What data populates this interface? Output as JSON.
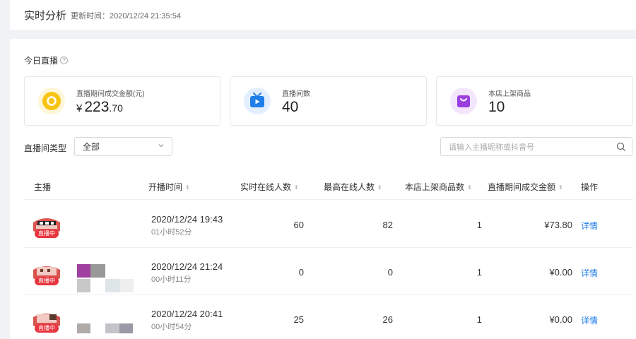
{
  "header": {
    "title": "实时分析",
    "update_label": "更新时间：2020/12/24 21:35:54"
  },
  "section": {
    "title": "今日直播",
    "help_icon": "question-circle-icon"
  },
  "stats": [
    {
      "label": "直播期间成交金额(元)",
      "currency": "¥",
      "integer": "223",
      "decimal": ".70",
      "icon": "coin-icon",
      "color": "#f8c514"
    },
    {
      "label": "直播间数",
      "value": "40",
      "icon": "tv-icon",
      "color": "#1f7ee8"
    },
    {
      "label": "本店上架商品",
      "value": "10",
      "icon": "shopping-bag-icon",
      "color": "#9b3fe0"
    }
  ],
  "filter": {
    "label": "直播间类型",
    "selected": "全部"
  },
  "search": {
    "placeholder": "请输入主播昵称或抖音号"
  },
  "table": {
    "columns": [
      "主播",
      "开播时间",
      "实时在线人数",
      "最高在线人数",
      "本店上架商品数",
      "直播期间成交金额",
      "操作"
    ],
    "rows": [
      {
        "badge": "直播中",
        "start": "2020/12/24 19:43",
        "duration": "01小时52分",
        "online": "60",
        "peak": "82",
        "products": "1",
        "amount": "¥73.80",
        "action": "详情"
      },
      {
        "badge": "直播中",
        "start": "2020/12/24 21:24",
        "duration": "00小时11分",
        "online": "0",
        "peak": "0",
        "products": "1",
        "amount": "¥0.00",
        "action": "详情"
      },
      {
        "badge": "直播中",
        "start": "2020/12/24 20:41",
        "duration": "00小时54分",
        "online": "25",
        "peak": "26",
        "products": "1",
        "amount": "¥0.00",
        "action": "详情"
      }
    ]
  }
}
